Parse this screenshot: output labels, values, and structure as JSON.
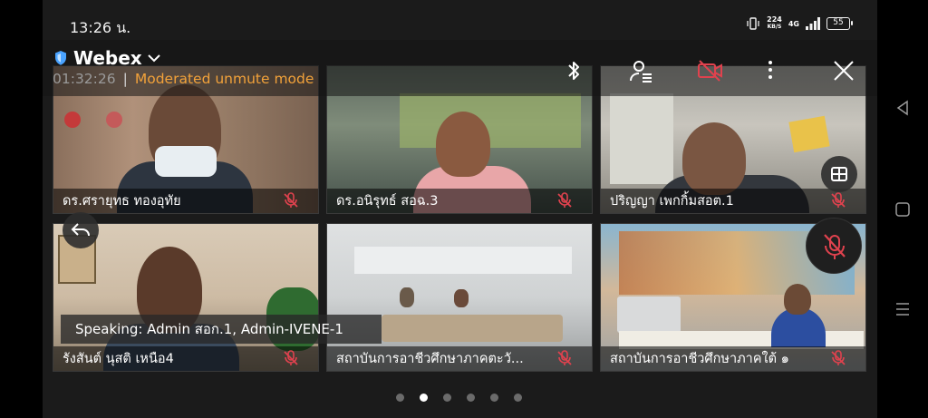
{
  "status_bar": {
    "time": "13:26 น.",
    "net_speed_value": "224",
    "net_speed_unit": "KB/S",
    "network": "4G",
    "battery": "55"
  },
  "header": {
    "app_title": "Webex",
    "timer": "01:32:26",
    "separator": "|",
    "mode": "Moderated unmute mode"
  },
  "participants": [
    {
      "name": "ดร.ศรายุทธ ทองอุทัย"
    },
    {
      "name": "ดร.อนิรุทธ์ สอฉ.3"
    },
    {
      "name": "ปริญญา เพกกิ้มสอต.1"
    },
    {
      "name": "รังสันต์ นุสติ เหนือ4"
    },
    {
      "name": "สถาบันการอาชีวศึกษาภาคตะวั..."
    },
    {
      "name": "สถาบันการอาชีวศึกษาภาคใต้ ๑"
    }
  ],
  "speaking": "Speaking: Admin สอก.1, Admin-IVENE-1",
  "pager": {
    "count": 6,
    "active_index": 1
  },
  "colors": {
    "accent_orange": "#f2a23a",
    "mute_red": "#e0424e",
    "shield_blue": "#4aa3ff"
  },
  "icons": {
    "top_bar": [
      "bluetooth-icon",
      "participants-icon",
      "video-off-icon",
      "more-vert-icon",
      "close-icon"
    ],
    "floating": [
      "layout-grid-icon",
      "back-icon",
      "mute-icon"
    ]
  }
}
